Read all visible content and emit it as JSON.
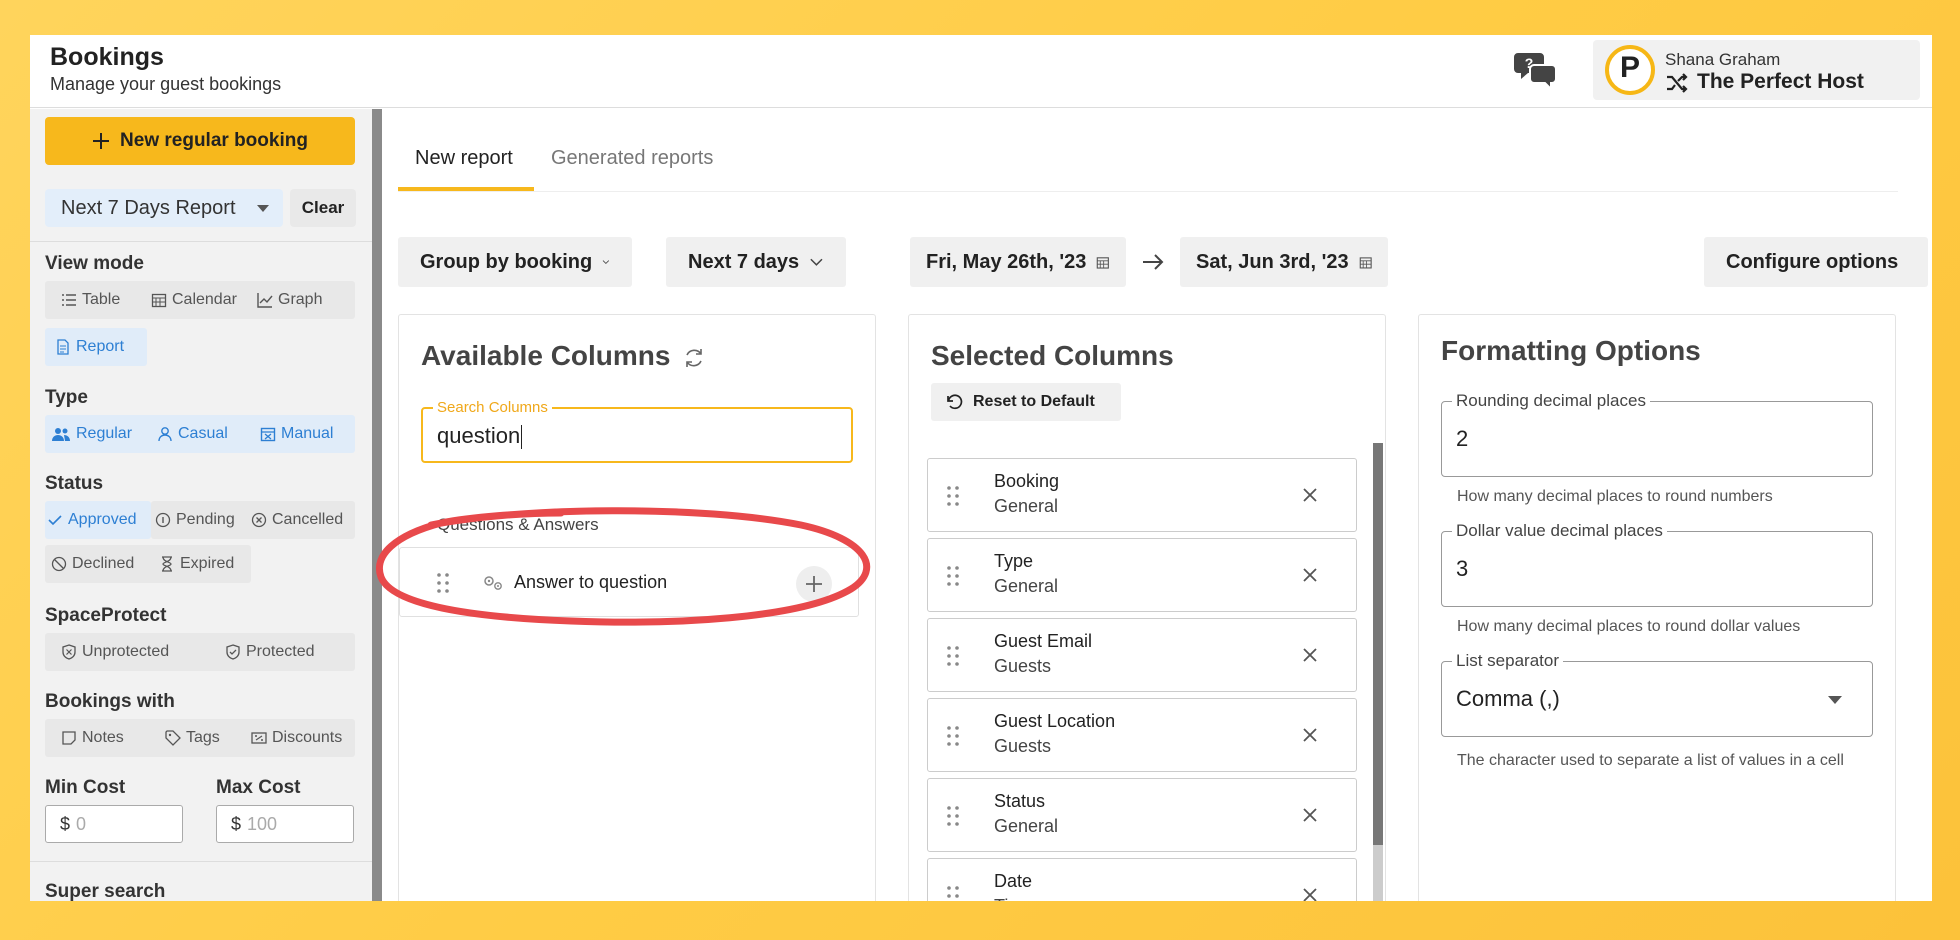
{
  "header": {
    "title": "Bookings",
    "subtitle": "Manage your guest bookings",
    "user_name": "Shana Graham",
    "org_name": "The Perfect Host",
    "logo_letter": "P"
  },
  "sidebar": {
    "new_booking_label": "New regular booking",
    "report_select": "Next 7 Days Report",
    "clear_label": "Clear",
    "view_mode": {
      "label": "View mode",
      "items": [
        "Table",
        "Calendar",
        "Graph",
        "Report"
      ],
      "active": "Report"
    },
    "type": {
      "label": "Type",
      "items": [
        "Regular",
        "Casual",
        "Manual"
      ]
    },
    "status": {
      "label": "Status",
      "items": [
        "Approved",
        "Pending",
        "Cancelled",
        "Declined",
        "Expired"
      ],
      "active": "Approved"
    },
    "spaceprotect": {
      "label": "SpaceProtect",
      "items": [
        "Unprotected",
        "Protected"
      ]
    },
    "bookings_with": {
      "label": "Bookings with",
      "items": [
        "Notes",
        "Tags",
        "Discounts"
      ]
    },
    "min_cost": {
      "label": "Min Cost",
      "currency": "$",
      "placeholder": "0"
    },
    "max_cost": {
      "label": "Max Cost",
      "currency": "$",
      "placeholder": "100"
    },
    "super_search_label": "Super search"
  },
  "tabs": [
    "New report",
    "Generated reports"
  ],
  "filters": {
    "group_by": "Group by booking",
    "range": "Next 7 days",
    "start_date": "Fri, May 26th, '23",
    "end_date": "Sat, Jun 3rd, '23",
    "configure": "Configure options"
  },
  "available": {
    "title": "Available Columns",
    "search_label": "Search Columns",
    "search_value": "question",
    "group_label": "Questions & Answers",
    "items": [
      {
        "label": "Answer to question"
      }
    ]
  },
  "selected": {
    "title": "Selected Columns",
    "reset_label": "Reset to Default",
    "items": [
      {
        "name": "Booking",
        "category": "General"
      },
      {
        "name": "Type",
        "category": "General"
      },
      {
        "name": "Guest Email",
        "category": "Guests"
      },
      {
        "name": "Guest Location",
        "category": "Guests"
      },
      {
        "name": "Status",
        "category": "General"
      },
      {
        "name": "Date",
        "category": "Times"
      }
    ]
  },
  "formatting": {
    "title": "Formatting Options",
    "rounding": {
      "label": "Rounding decimal places",
      "value": "2",
      "help": "How many decimal places to round numbers"
    },
    "dollar": {
      "label": "Dollar value decimal places",
      "value": "3",
      "help": "How many decimal places to round dollar values"
    },
    "separator": {
      "label": "List separator",
      "value": "Comma (,)",
      "help": "The character used to separate a list of values in a cell"
    }
  },
  "colors": {
    "accent": "#f7b81c",
    "link_blue": "#2d7fd3",
    "highlight_red": "#e8494b"
  }
}
